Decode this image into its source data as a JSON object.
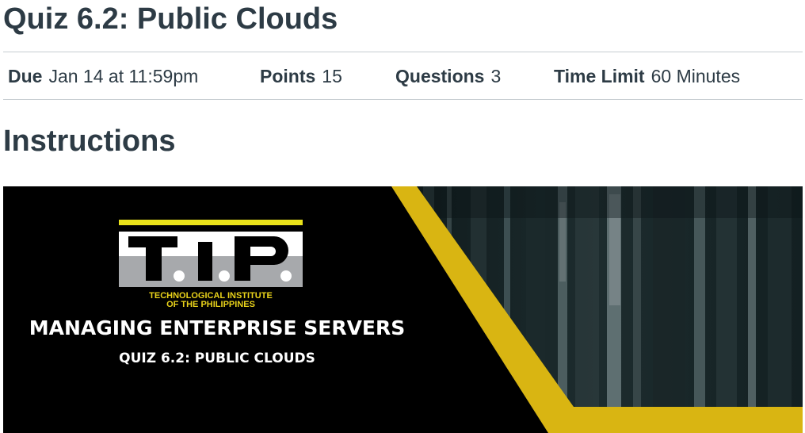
{
  "page": {
    "title": "Quiz 6.2: Public Clouds"
  },
  "details": {
    "due": {
      "label": "Due",
      "value": "Jan 14 at 11:59pm"
    },
    "points": {
      "label": "Points",
      "value": "15"
    },
    "questions": {
      "label": "Questions",
      "value": "3"
    },
    "time_limit": {
      "label": "Time Limit",
      "value": "60 Minutes"
    }
  },
  "instructions": {
    "heading": "Instructions",
    "banner": {
      "logo_text": "T.i.P.",
      "logo_caption_line1": "TECHNOLOGICAL INSTITUTE",
      "logo_caption_line2": "OF THE PHILIPPINES",
      "course_title": "MANAGING ENTERPRISE SERVERS",
      "quiz_title": "QUIZ 6.2: PUBLIC CLOUDS"
    }
  },
  "colors": {
    "text": "#2d3b45",
    "divider": "#c7cdd1",
    "banner_black": "#000000",
    "banner_yellow": "#d9b512",
    "logo_yellow": "#e9e21a"
  }
}
